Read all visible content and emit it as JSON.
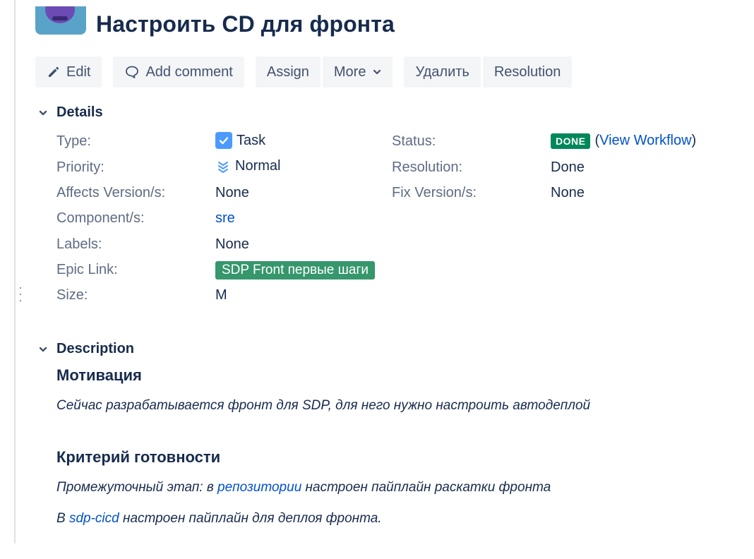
{
  "issue": {
    "title": "Настроить CD для фронта"
  },
  "toolbar": {
    "edit": "Edit",
    "add_comment": "Add comment",
    "assign": "Assign",
    "more": "More",
    "delete": "Удалить",
    "resolution": "Resolution"
  },
  "details": {
    "heading": "Details",
    "type_label": "Type:",
    "type_value": "Task",
    "priority_label": "Priority:",
    "priority_value": "Normal",
    "affects_label": "Affects Version/s:",
    "affects_value": "None",
    "component_label": "Component/s:",
    "component_value": "sre",
    "labels_label": "Labels:",
    "labels_value": "None",
    "epic_label": "Epic Link:",
    "epic_value": "SDP Front первые шаги",
    "size_label": "Size:",
    "size_value": "M",
    "status_label": "Status:",
    "status_value": "DONE",
    "view_workflow_open": "(",
    "view_workflow": "View Workflow",
    "view_workflow_close": ")",
    "resolution_label": "Resolution:",
    "resolution_value": "Done",
    "fix_label": "Fix Version/s:",
    "fix_value": "None"
  },
  "description": {
    "heading": "Description",
    "h1": "Мотивация",
    "p1": "Сейчас разрабатывается фронт для SDP, для него нужно настроить автодеплой",
    "h2": "Критерий готовности",
    "p2_before": "Промежуточный этап: в ",
    "p2_link": "репозитории",
    "p2_after": " настроен пайплайн раскатки фронта",
    "p3_before": "В ",
    "p3_link": "sdp-cicd",
    "p3_after": " настроен пайплайн для деплоя фронта."
  },
  "icons": {
    "edit": "pencil-icon",
    "comment": "comment-icon",
    "more_caret": "chevron-down-icon",
    "section_toggle": "chevron-down-icon",
    "type": "task-checkbox-icon",
    "priority": "priority-normal-icon",
    "avatar": "project-avatar"
  },
  "colors": {
    "done_lozenge": "#00875a",
    "epic_lozenge": "#36966c",
    "link": "#0052cc",
    "task_icon": "#4c9aff",
    "button_bg": "#f4f5f7"
  }
}
